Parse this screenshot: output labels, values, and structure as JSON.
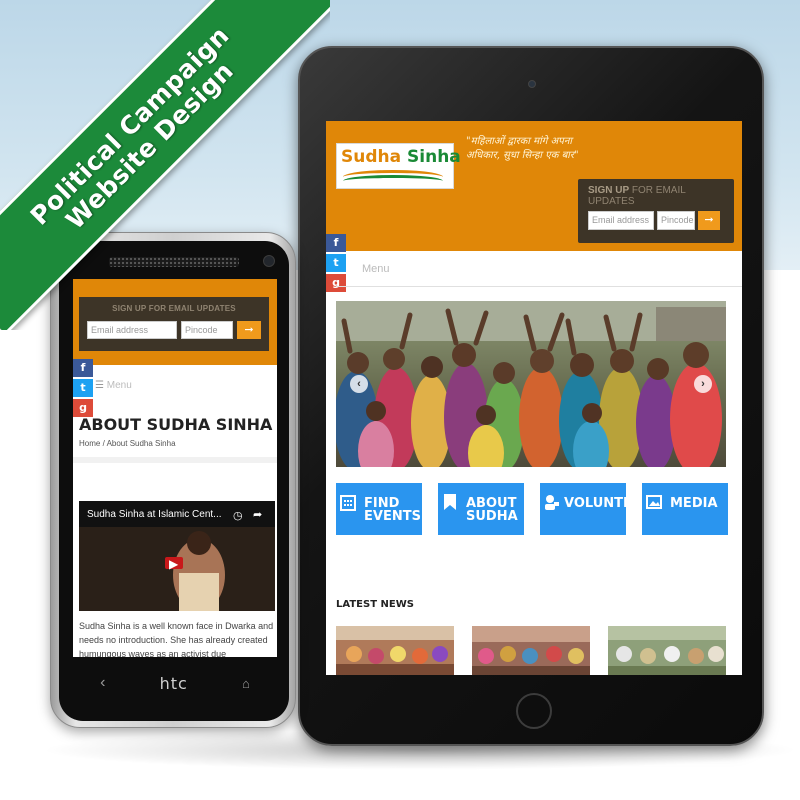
{
  "banner": {
    "line1": "Political Campaign",
    "line2": "Website Design"
  },
  "colors": {
    "ribbon": "#1c8a3a",
    "header_orange": "#e08708",
    "signup_bg": "#3d3427",
    "tile_blue": "#2a95ef",
    "go_button": "#f09a1c"
  },
  "tablet": {
    "logo": {
      "part1": "Sudha",
      "part2": "Sinha"
    },
    "tagline": "\"महिलाओं द्वारका मांगे अपना अधिकार, सुधा सिन्हा एक बार\"",
    "signup": {
      "title_bold": "SIGN UP",
      "title_rest": "FOR EMAIL UPDATES",
      "email_placeholder": "Email address",
      "pincode_placeholder": "Pincode",
      "go_icon": "arrow-right-icon"
    },
    "social": [
      "f",
      "t",
      "g"
    ],
    "menu_label": "Menu",
    "slider": {
      "prev_icon": "chevron-left-icon",
      "next_icon": "chevron-right-icon"
    },
    "tiles": [
      {
        "label": "FIND\nEVENTS",
        "icon": "calendar-icon"
      },
      {
        "label": "ABOUT\nSUDHA",
        "icon": "bookmark-icon"
      },
      {
        "label": "VOLUNTEER",
        "icon": "volunteer-icon"
      },
      {
        "label": "MEDIA",
        "icon": "image-icon"
      }
    ],
    "latest_news_title": "LATEST NEWS"
  },
  "phone": {
    "signup_title": "SIGN UP FOR EMAIL UPDATES",
    "email_placeholder": "Email address",
    "pincode_placeholder": "Pincode",
    "social": [
      "f",
      "t",
      "g"
    ],
    "menu_label": "Menu",
    "page_title": "ABOUT SUDHA SINHA",
    "breadcrumb": "Home / About Sudha Sinha",
    "video_title": "Sudha Sinha at Islamic Cent...",
    "body_text": "Sudha Sinha is a well known face in Dwarka and needs no introduction. She has already created humungous waves as an activist due",
    "brand": "htc",
    "nav_back": "‹",
    "nav_home": "⌂"
  }
}
